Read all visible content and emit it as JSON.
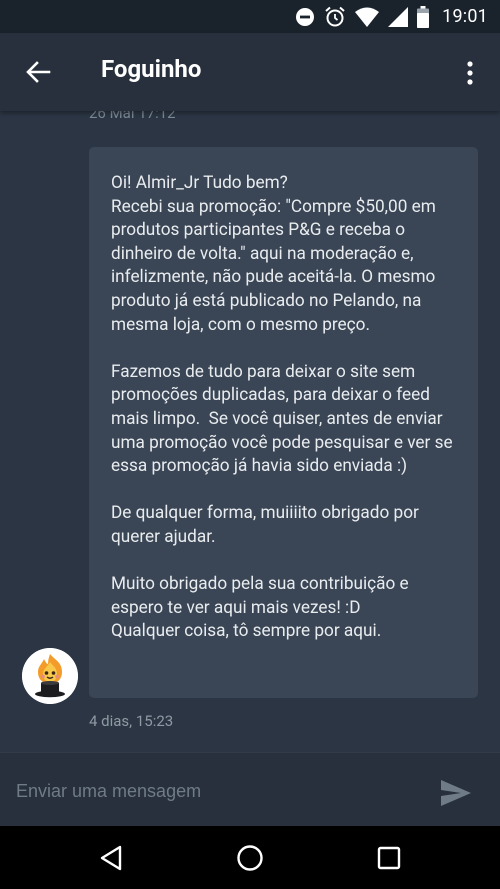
{
  "status_bar": {
    "time": "19:01",
    "icons": [
      "do-not-disturb-icon",
      "alarm-icon",
      "wifi-icon",
      "signal-icon",
      "battery-icon"
    ]
  },
  "app_bar": {
    "title": "Foguinho",
    "back_icon": "arrow-left-icon",
    "menu_icon": "more-vertical-icon"
  },
  "conversation": {
    "previous_timestamp": "26 Mai 17:12",
    "message": {
      "text": "Oi! Almir_Jr Tudo bem?\nRecebi sua promoção: \"Compre $50,00 em produtos participantes P&G e receba o dinheiro de volta.\" aqui na moderação e, infelizmente, não pude aceitá-la. O mesmo produto já está publicado no Pelando, na mesma loja, com o mesmo preço.\n\nFazemos de tudo para deixar o site sem promoções duplicadas, para deixar o feed mais limpo.  Se você quiser, antes de enviar uma promoção você pode pesquisar e ver se essa promoção já havia sido enviada :)\n\nDe qualquer forma, muiiiito obrigado por querer ajudar.\n\nMuito obrigado pela sua contribuição e espero te ver aqui mais vezes! :D\nQualquer coisa, tô sempre por aqui.",
      "timestamp": "4 dias, 15:23",
      "avatar_icon": "flame-mascot-top-hat-icon"
    }
  },
  "composer": {
    "placeholder": "Enviar uma mensagem",
    "value": "",
    "send_icon": "send-icon"
  },
  "nav_bar": {
    "icons": [
      "back-triangle-icon",
      "home-circle-icon",
      "recents-square-icon"
    ]
  },
  "colors": {
    "background": "#2b3543",
    "app_bar": "#27303c",
    "bubble": "#3a4655",
    "status_bar": "#1a222c",
    "nav_bar": "#000000"
  }
}
